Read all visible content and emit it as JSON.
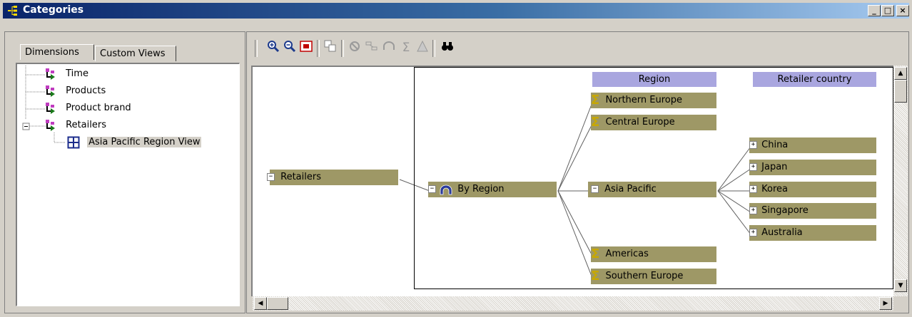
{
  "window": {
    "title": "Categories",
    "controls": {
      "minimize": "_",
      "maximize": "□",
      "close": "×"
    }
  },
  "tabs": [
    {
      "label": "Dimensions",
      "active": true
    },
    {
      "label": "Custom Views",
      "active": false
    }
  ],
  "tree": [
    {
      "label": "Time",
      "icon": "dimension-icon"
    },
    {
      "label": "Products",
      "icon": "dimension-icon"
    },
    {
      "label": "Product brand",
      "icon": "dimension-icon"
    },
    {
      "label": "Retailers",
      "icon": "dimension-icon",
      "expanded": true
    },
    {
      "label": "Asia Pacific Region View",
      "icon": "custom-view-grid-icon",
      "selected": true
    }
  ],
  "toolbar": {
    "buttons": [
      "zoom-in-icon",
      "zoom-out-icon",
      "fit-to-window-icon",
      "copy-icon",
      "exclude-icon",
      "suppress-icon",
      "alternate-drill-icon",
      "summary-icon",
      "special-category-icon",
      "find-icon"
    ]
  },
  "levels": [
    {
      "label": "Region"
    },
    {
      "label": "Retailer country"
    }
  ],
  "diagram": {
    "root": {
      "label": "Retailers",
      "sign": "−"
    },
    "drill": {
      "label": "By Region",
      "sign": "−"
    },
    "regions": [
      {
        "label": "Northern Europe",
        "kind": "summary"
      },
      {
        "label": "Central Europe",
        "kind": "summary"
      },
      {
        "label": "Asia Pacific",
        "kind": "expanded",
        "sign": "−"
      },
      {
        "label": "Americas",
        "kind": "summary"
      },
      {
        "label": "Southern Europe",
        "kind": "summary"
      }
    ],
    "countries": [
      {
        "label": "China",
        "sign": "+"
      },
      {
        "label": "Japan",
        "sign": "+"
      },
      {
        "label": "Korea",
        "sign": "+"
      },
      {
        "label": "Singapore",
        "sign": "+"
      },
      {
        "label": "Australia",
        "sign": "+"
      }
    ]
  },
  "colors": {
    "node_fill": "#9e9866",
    "header_fill": "#a9a6df",
    "titlebar_start": "#0a246a",
    "titlebar_end": "#a6caf0"
  }
}
